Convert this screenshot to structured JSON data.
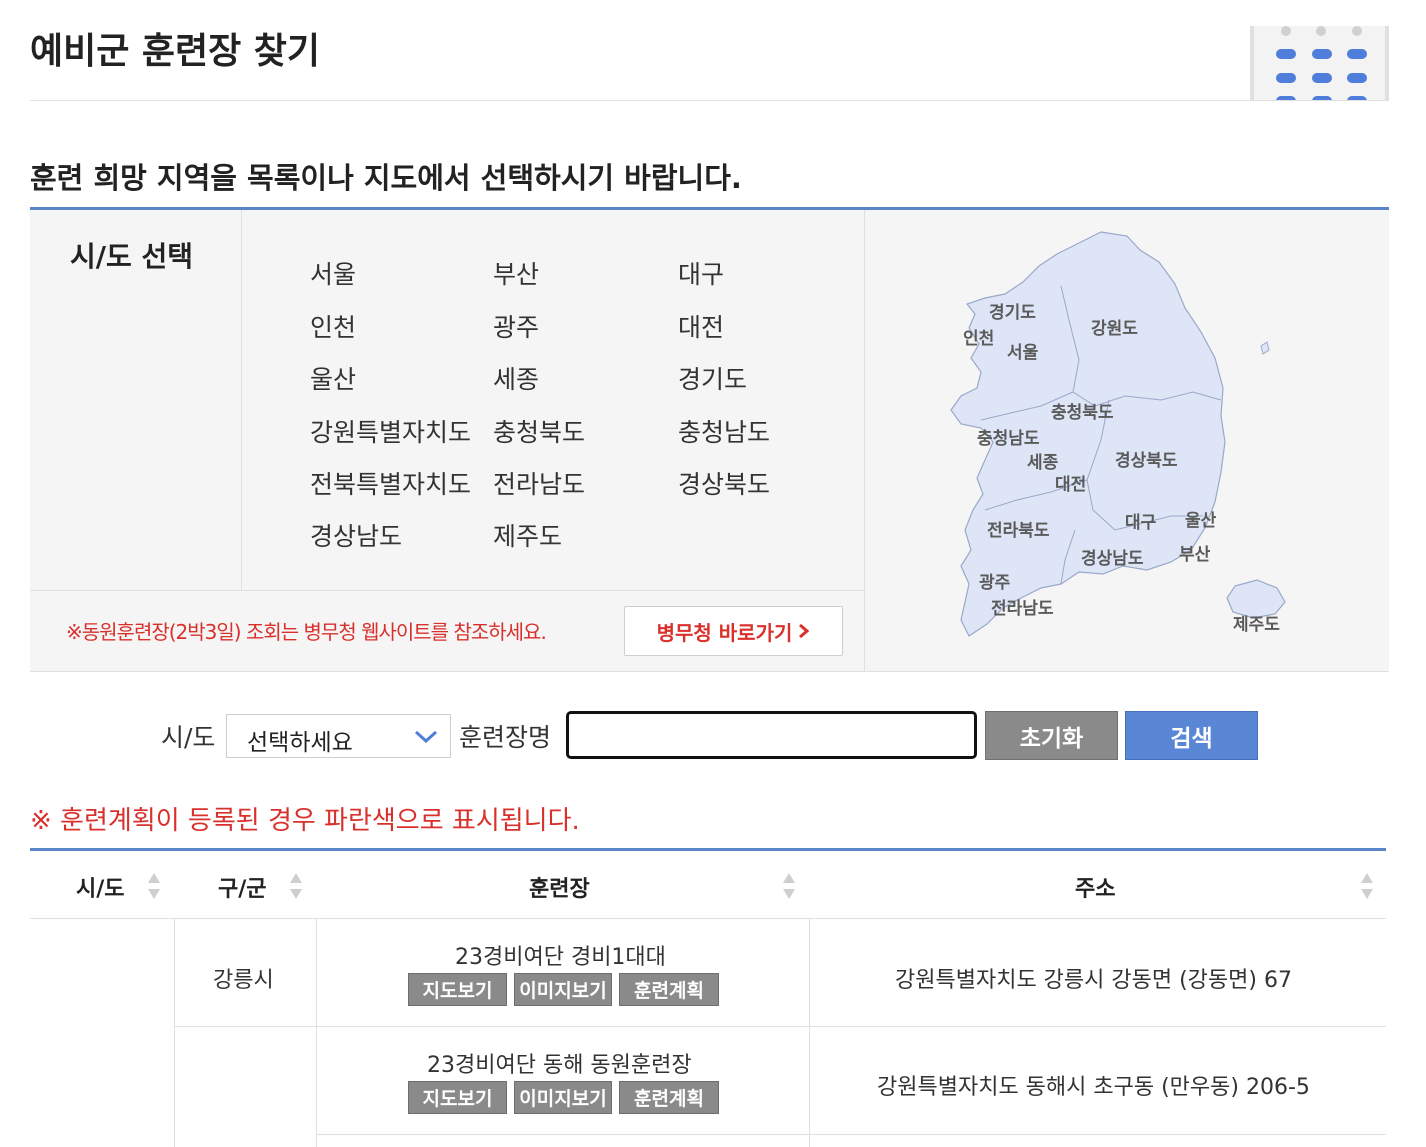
{
  "page": {
    "title": "예비군 훈련장 찾기",
    "instruction": "훈련 희망 지역을 목록이나 지도에서 선택하시기 바랍니다."
  },
  "region": {
    "heading": "시/도 선택",
    "items": [
      "서울",
      "부산",
      "대구",
      "인천",
      "광주",
      "대전",
      "울산",
      "세종",
      "경기도",
      "강원특별자치도",
      "충청북도",
      "충청남도",
      "전북특별자치도",
      "전라남도",
      "경상북도",
      "경상남도",
      "제주도"
    ],
    "mma_note": "※동원훈련장(2박3일) 조회는 병무청 웹사이트를 참조하세요.",
    "mma_button": "병무청 바로가기"
  },
  "map_labels": [
    "경기도",
    "인천",
    "서울",
    "강원도",
    "충청북도",
    "충청남도",
    "세종",
    "대전",
    "경상북도",
    "전라북도",
    "대구",
    "울산",
    "경상남도",
    "부산",
    "광주",
    "전라남도",
    "제주도"
  ],
  "search": {
    "sido_label": "시/도",
    "sido_selected": "선택하세요",
    "name_label": "훈련장명",
    "name_value": "",
    "reset_label": "초기화",
    "search_label": "검색"
  },
  "blue_note": "※ 훈련계획이 등록된 경우 파란색으로 표시됩니다.",
  "table": {
    "columns": [
      "시/도",
      "구/군",
      "훈련장",
      "주소"
    ],
    "action_labels": [
      "지도보기",
      "이미지보기",
      "훈련계획"
    ],
    "rows": [
      {
        "sido": "",
        "gugun": "강릉시",
        "name": "23경비여단 경비1대대",
        "address": "강원특별자치도 강릉시 강동면 (강동면) 67"
      },
      {
        "sido": "",
        "gugun": "",
        "name": "23경비여단 동해 동원훈련장",
        "address": "강원특별자치도 동해시 초구동 (만우동) 206-5"
      }
    ]
  },
  "colors": {
    "accent_blue": "#5a86c9",
    "search_blue": "#5a86d6",
    "warning_red": "#d9302c",
    "map_fill": "#dde5f7"
  }
}
